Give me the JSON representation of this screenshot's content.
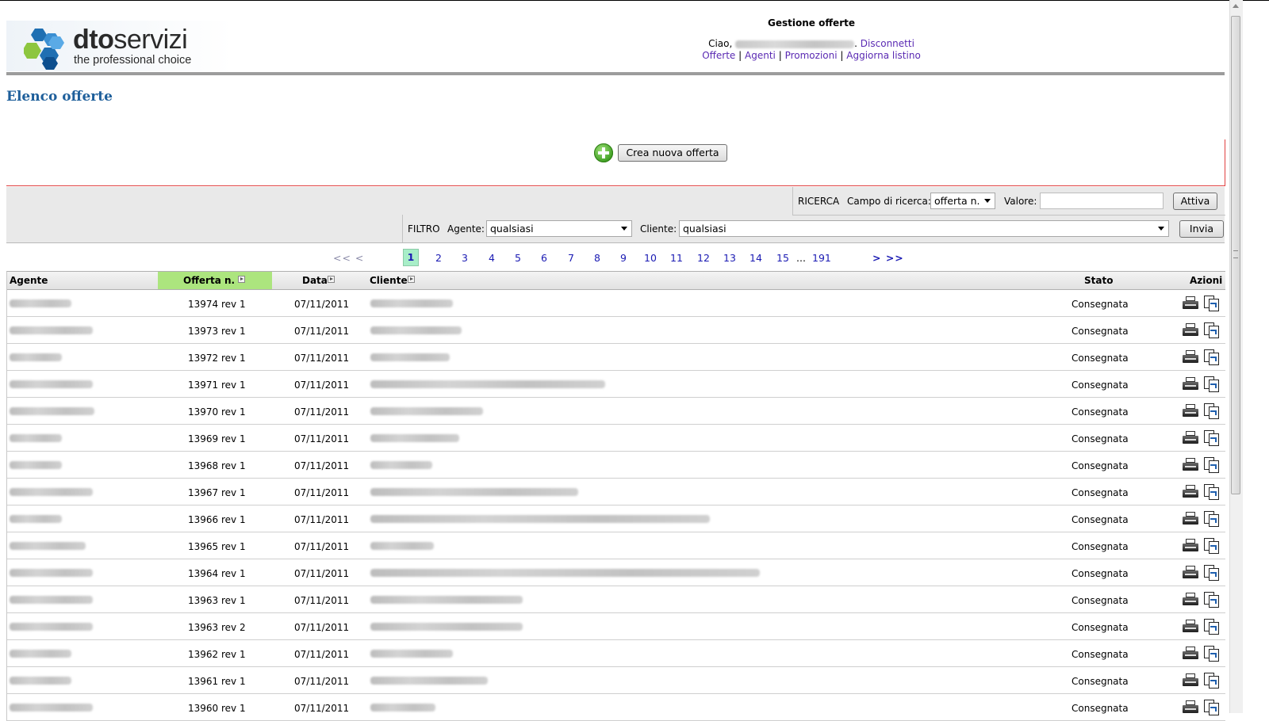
{
  "header": {
    "logo_title_bold": "dto",
    "logo_title_rest": "servizi",
    "logo_subtitle": "the professional choice",
    "title": "Gestione offerte",
    "greeting": "Ciao,",
    "logout": "Disconnetti",
    "nav": [
      "Offerte",
      "Agenti",
      "Promozioni",
      "Aggiorna listino"
    ],
    "nav_separator": "|"
  },
  "page_title": "Elenco offerte",
  "create_button": "Crea nuova offerta",
  "search": {
    "section_label": "RICERCA",
    "field_label": "Campo di ricerca:",
    "field_value": "offerta n.",
    "value_label": "Valore:",
    "value": "",
    "submit": "Attiva"
  },
  "filter": {
    "section_label": "FILTRO",
    "agent_label": "Agente:",
    "agent_value": "qualsiasi",
    "client_label": "Cliente:",
    "client_value": "qualsiasi",
    "submit": "Invia"
  },
  "pagination": {
    "prev": "<< <",
    "pages": [
      "1",
      "2",
      "3",
      "4",
      "5",
      "6",
      "7",
      "8",
      "9",
      "10",
      "11",
      "12",
      "13",
      "14",
      "15"
    ],
    "current": "1",
    "ellipsis": "...",
    "last": "191",
    "next": "> >>"
  },
  "table": {
    "columns": {
      "agente": "Agente",
      "offerta": "Offerta n.",
      "data": "Data",
      "cliente": "Cliente",
      "stato": "Stato",
      "azioni": "Azioni"
    },
    "rows": [
      {
        "offerta": "13974 rev 1",
        "data": "07/11/2011",
        "stato": "Consegnata"
      },
      {
        "offerta": "13973 rev 1",
        "data": "07/11/2011",
        "stato": "Consegnata"
      },
      {
        "offerta": "13972 rev 1",
        "data": "07/11/2011",
        "stato": "Consegnata"
      },
      {
        "offerta": "13971 rev 1",
        "data": "07/11/2011",
        "stato": "Consegnata"
      },
      {
        "offerta": "13970 rev 1",
        "data": "07/11/2011",
        "stato": "Consegnata"
      },
      {
        "offerta": "13969 rev 1",
        "data": "07/11/2011",
        "stato": "Consegnata"
      },
      {
        "offerta": "13968 rev 1",
        "data": "07/11/2011",
        "stato": "Consegnata"
      },
      {
        "offerta": "13967 rev 1",
        "data": "07/11/2011",
        "stato": "Consegnata"
      },
      {
        "offerta": "13966 rev 1",
        "data": "07/11/2011",
        "stato": "Consegnata"
      },
      {
        "offerta": "13965 rev 1",
        "data": "07/11/2011",
        "stato": "Consegnata"
      },
      {
        "offerta": "13964 rev 1",
        "data": "07/11/2011",
        "stato": "Consegnata"
      },
      {
        "offerta": "13963 rev 1",
        "data": "07/11/2011",
        "stato": "Consegnata"
      },
      {
        "offerta": "13963 rev 2",
        "data": "07/11/2011",
        "stato": "Consegnata"
      },
      {
        "offerta": "13962 rev 1",
        "data": "07/11/2011",
        "stato": "Consegnata"
      },
      {
        "offerta": "13961 rev 1",
        "data": "07/11/2011",
        "stato": "Consegnata"
      },
      {
        "offerta": "13960 rev 1",
        "data": "07/11/2011",
        "stato": "Consegnata"
      }
    ]
  },
  "colors": {
    "title_blue": "#1e5f9b",
    "link_purple": "#5a2ab3",
    "sorted_column_green": "#ace57e",
    "current_page_green": "#a8eec8",
    "accent_red": "#e04040"
  }
}
